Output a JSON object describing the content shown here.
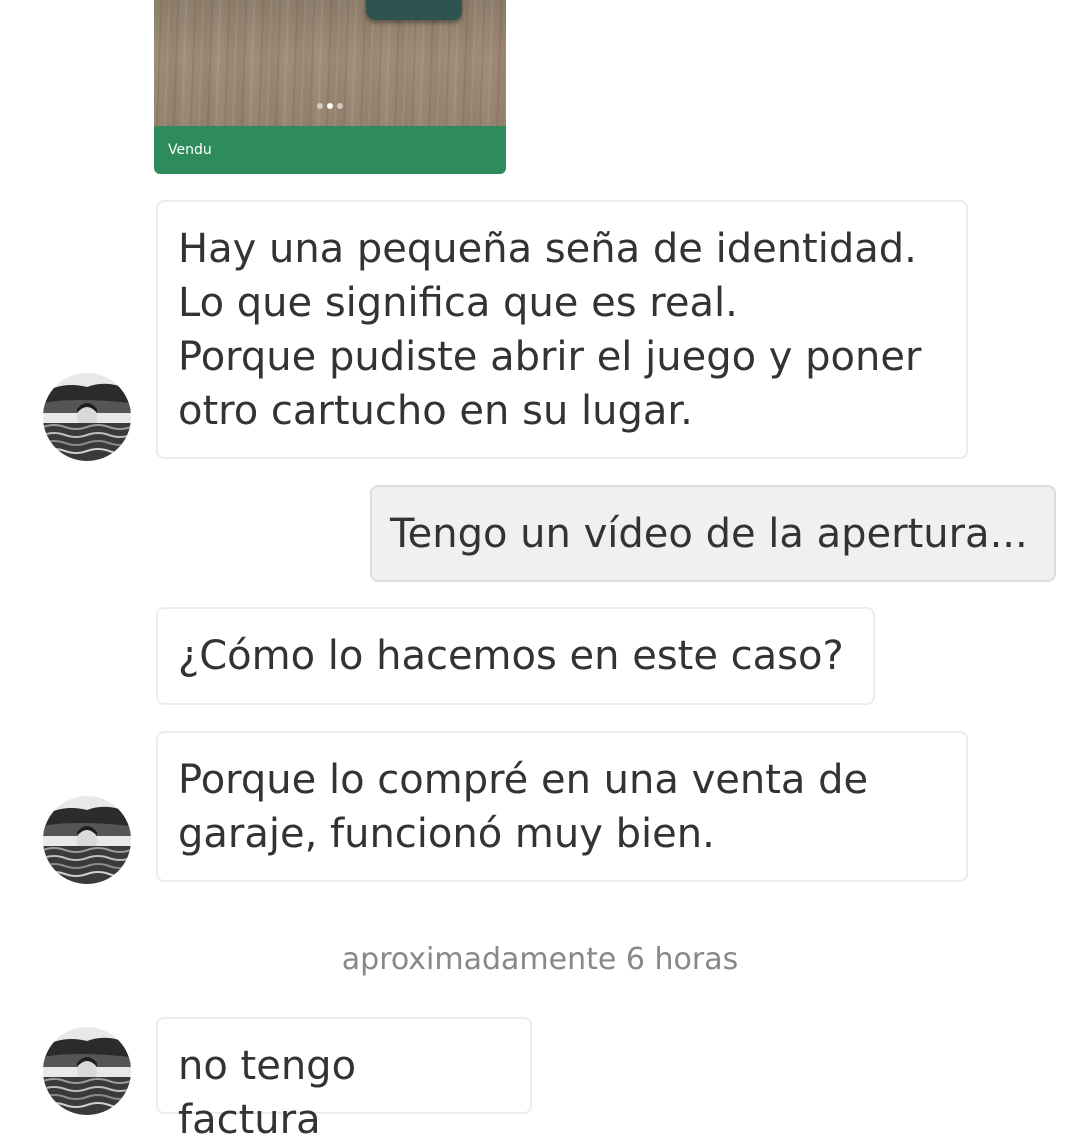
{
  "product": {
    "status_label": "Vendu",
    "carousel": {
      "count": 3,
      "active_index": 1
    }
  },
  "messages": [
    {
      "direction": "incoming",
      "text": "Hay una pequeña seña de identidad.\nLo que significa que es real.\nPorque pudiste abrir el juego y poner otro cartucho en su lugar."
    },
    {
      "direction": "outgoing",
      "text": "Tengo un vídeo de la apertura..."
    },
    {
      "direction": "incoming",
      "text": "¿Cómo lo hacemos en este caso?"
    },
    {
      "direction": "incoming",
      "text": "Porque lo compré en una venta de garaje, funcionó muy bien."
    },
    {
      "direction": "incoming",
      "text": "no tengo factura"
    }
  ],
  "timestamp": "aproximadamente 6 horas",
  "colors": {
    "sold_banner": "#2e8b5b",
    "incoming_bubble": "#ffffff",
    "outgoing_bubble": "#f0f0f0",
    "text": "#333333",
    "timestamp_text": "#888888"
  },
  "icons": {
    "avatar": "user-avatar-photo"
  }
}
